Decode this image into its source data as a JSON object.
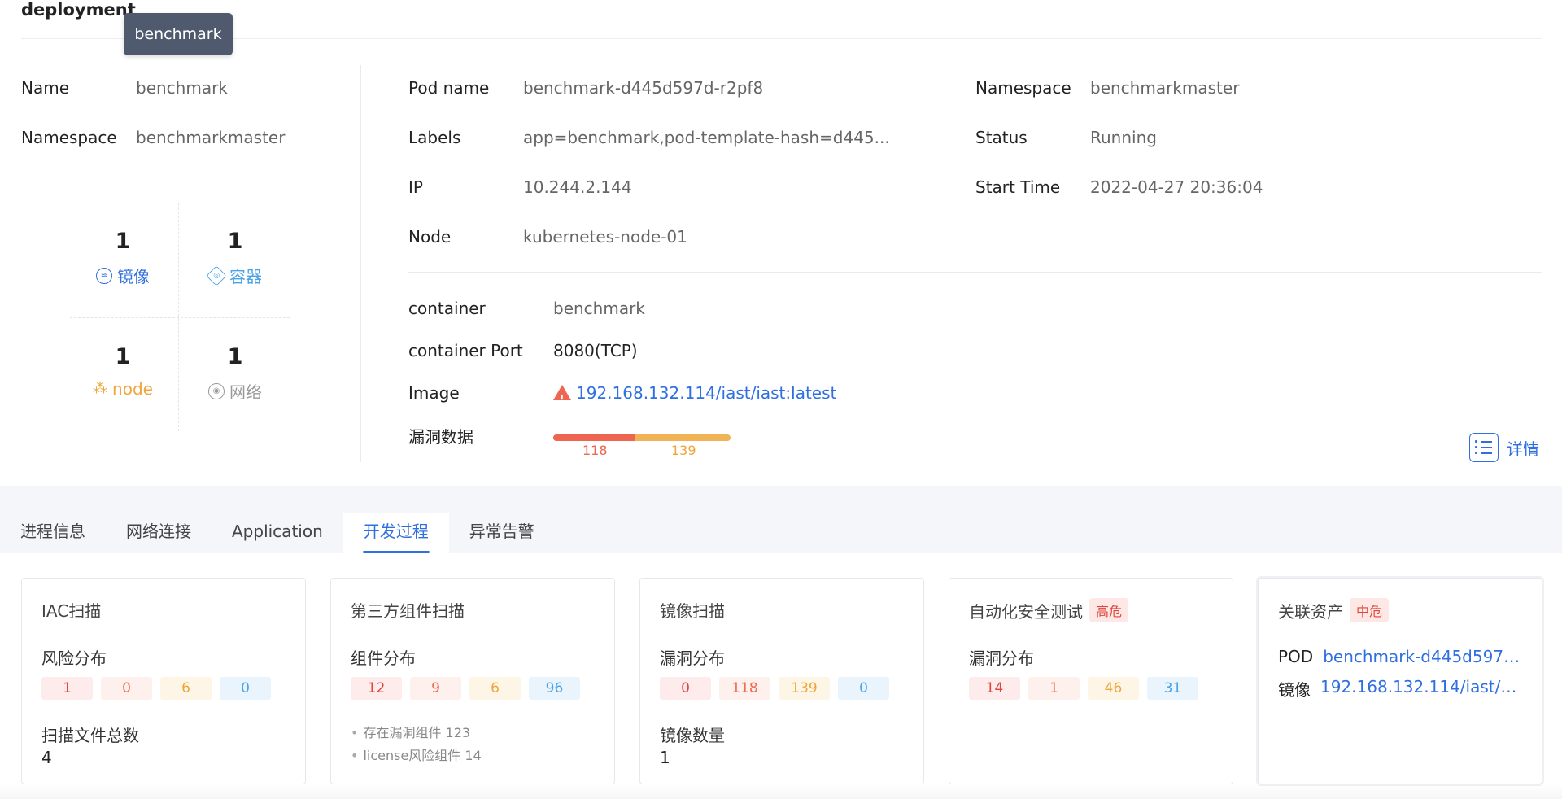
{
  "section": {
    "title": "deployment"
  },
  "tooltip": {
    "text": "benchmark"
  },
  "deployment": {
    "name_label": "Name",
    "name_value": "benchmark",
    "namespace_label": "Namespace",
    "namespace_value": "benchmarkmaster"
  },
  "stats": [
    {
      "count": "1",
      "label": "镜像",
      "icon": "layers-icon",
      "color": "#2f6fe0"
    },
    {
      "count": "1",
      "label": "容器",
      "icon": "container-icon",
      "color": "#4aa3e8"
    },
    {
      "count": "1",
      "label": "node",
      "icon": "node-icon",
      "color": "#f0a53a"
    },
    {
      "count": "1",
      "label": "网络",
      "icon": "network-icon",
      "color": "#999999"
    }
  ],
  "pod": {
    "pod_name_label": "Pod name",
    "pod_name_value": "benchmark-d445d597d-r2pf8",
    "labels_label": "Labels",
    "labels_value": "app=benchmark,pod-template-hash=d445...",
    "ip_label": "IP",
    "ip_value": "10.244.2.144",
    "node_label": "Node",
    "node_value": "kubernetes-node-01",
    "namespace_label": "Namespace",
    "namespace_value": "benchmarkmaster",
    "status_label": "Status",
    "status_value": "Running",
    "start_time_label": "Start Time",
    "start_time_value": "2022-04-27 20:36:04"
  },
  "container": {
    "container_label": "container",
    "container_value": "benchmark",
    "port_label": "container Port",
    "port_value": "8080(TCP)",
    "image_label": "Image",
    "image_value": "192.168.132.114/iast/iast:latest",
    "vuln_label": "漏洞数据",
    "vuln_high": 118,
    "vuln_medium": 139,
    "vuln_high_text": "118",
    "vuln_medium_text": "139",
    "detail_label": "详情"
  },
  "tabs": [
    {
      "label": "进程信息",
      "active": false
    },
    {
      "label": "网络连接",
      "active": false
    },
    {
      "label": "Application",
      "active": false
    },
    {
      "label": "开发过程",
      "active": true
    },
    {
      "label": "异常告警",
      "active": false
    }
  ],
  "cards": {
    "iac": {
      "title": "IAC扫描",
      "dist_label": "风险分布",
      "counts": [
        "1",
        "0",
        "6",
        "0"
      ],
      "total_label": "扫描文件总数",
      "total_value": "4"
    },
    "third_party": {
      "title": "第三方组件扫描",
      "dist_label": "组件分布",
      "counts": [
        "12",
        "9",
        "6",
        "96"
      ],
      "bullet_1": "存在漏洞组件 123",
      "bullet_2": "license风险组件 14"
    },
    "image_scan": {
      "title": "镜像扫描",
      "dist_label": "漏洞分布",
      "counts": [
        "0",
        "118",
        "139",
        "0"
      ],
      "count_label": "镜像数量",
      "count_value": "1"
    },
    "auto_test": {
      "title": "自动化安全测试",
      "badge": "高危",
      "dist_label": "漏洞分布",
      "counts": [
        "14",
        "1",
        "46",
        "31"
      ]
    },
    "assets": {
      "title": "关联资产",
      "badge": "中危",
      "pod_label": "POD",
      "pod_value": "benchmark-d445d597d...",
      "image_label": "镜像",
      "image_value": "192.168.132.114/iast/ias..."
    }
  }
}
